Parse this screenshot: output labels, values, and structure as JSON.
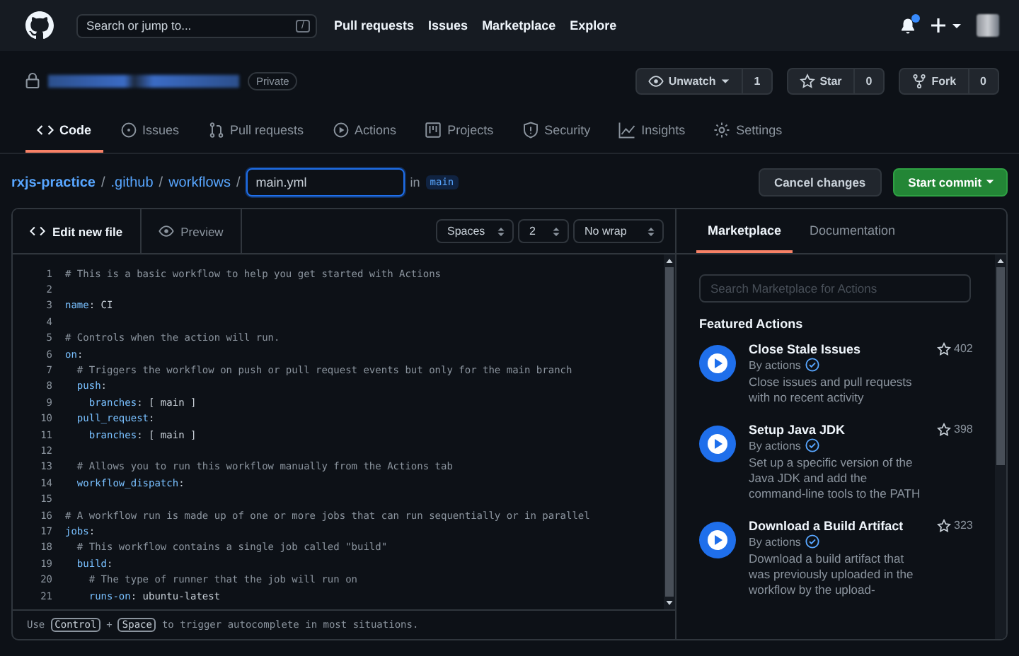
{
  "topnav": {
    "search_placeholder": "Search or jump to...",
    "search_key": "/",
    "links": [
      "Pull requests",
      "Issues",
      "Marketplace",
      "Explore"
    ],
    "notification_unread": true
  },
  "repo": {
    "visibility": "Private",
    "buttons": [
      {
        "label": "Unwatch",
        "count": "1",
        "kind": "watch",
        "caret": true
      },
      {
        "label": "Star",
        "count": "0",
        "kind": "star",
        "caret": false
      },
      {
        "label": "Fork",
        "count": "0",
        "kind": "fork",
        "caret": false
      }
    ]
  },
  "tabs": [
    {
      "label": "Code",
      "kind": "code",
      "selected": true
    },
    {
      "label": "Issues",
      "kind": "issues",
      "selected": false
    },
    {
      "label": "Pull requests",
      "kind": "pulls",
      "selected": false
    },
    {
      "label": "Actions",
      "kind": "actions",
      "selected": false
    },
    {
      "label": "Projects",
      "kind": "projects",
      "selected": false
    },
    {
      "label": "Security",
      "kind": "security",
      "selected": false
    },
    {
      "label": "Insights",
      "kind": "insights",
      "selected": false
    },
    {
      "label": "Settings",
      "kind": "settings",
      "selected": false
    }
  ],
  "breadcrumb": {
    "repo": "rxjs-practice",
    "separator": "/",
    "path": [
      ".github",
      "workflows"
    ],
    "filename": "main.yml",
    "in_label": "in",
    "branch": "main"
  },
  "actions": {
    "cancel": "Cancel changes",
    "commit": "Start commit"
  },
  "editor": {
    "tabs": [
      {
        "label": "Edit new file",
        "kind": "edit",
        "selected": true
      },
      {
        "label": "Preview",
        "kind": "preview",
        "selected": false
      }
    ],
    "selects": [
      "Spaces",
      "2",
      "No wrap"
    ],
    "lines": [
      {
        "number": "1",
        "segments": [
          {
            "kind": "comment",
            "text": "# This is a basic workflow to help you get started with Actions"
          }
        ]
      },
      {
        "number": "2"
      },
      {
        "number": "3",
        "segments": [
          {
            "kind": "key",
            "text": "name"
          },
          {
            "kind": "plain",
            "text": ": CI"
          }
        ]
      },
      {
        "number": "4"
      },
      {
        "number": "5",
        "segments": [
          {
            "kind": "comment",
            "text": "# Controls when the action will run."
          }
        ]
      },
      {
        "number": "6",
        "segments": [
          {
            "kind": "key",
            "text": "on"
          },
          {
            "kind": "plain",
            "text": ":"
          }
        ]
      },
      {
        "number": "7",
        "segments": [
          {
            "kind": "comment",
            "text": "  # Triggers the workflow on push or pull request events but only for the main branch"
          }
        ]
      },
      {
        "number": "8",
        "segments": [
          {
            "kind": "key",
            "text": "  push"
          },
          {
            "kind": "plain",
            "text": ":"
          }
        ]
      },
      {
        "number": "9",
        "segments": [
          {
            "kind": "key",
            "text": "    branches"
          },
          {
            "kind": "plain",
            "text": ": [ main ]"
          }
        ]
      },
      {
        "number": "10",
        "segments": [
          {
            "kind": "key",
            "text": "  pull_request"
          },
          {
            "kind": "plain",
            "text": ":"
          }
        ]
      },
      {
        "number": "11",
        "segments": [
          {
            "kind": "key",
            "text": "    branches"
          },
          {
            "kind": "plain",
            "text": ": [ main ]"
          }
        ]
      },
      {
        "number": "12"
      },
      {
        "number": "13",
        "segments": [
          {
            "kind": "comment",
            "text": "  # Allows you to run this workflow manually from the Actions tab"
          }
        ]
      },
      {
        "number": "14",
        "segments": [
          {
            "kind": "key",
            "text": "  workflow_dispatch"
          },
          {
            "kind": "plain",
            "text": ":"
          }
        ]
      },
      {
        "number": "15"
      },
      {
        "number": "16",
        "segments": [
          {
            "kind": "comment",
            "text": "# A workflow run is made up of one or more jobs that can run sequentially or in parallel"
          }
        ]
      },
      {
        "number": "17",
        "segments": [
          {
            "kind": "key",
            "text": "jobs"
          },
          {
            "kind": "plain",
            "text": ":"
          }
        ]
      },
      {
        "number": "18",
        "segments": [
          {
            "kind": "comment",
            "text": "  # This workflow contains a single job called \"build\""
          }
        ]
      },
      {
        "number": "19",
        "segments": [
          {
            "kind": "key",
            "text": "  build"
          },
          {
            "kind": "plain",
            "text": ":"
          }
        ]
      },
      {
        "number": "20",
        "segments": [
          {
            "kind": "comment",
            "text": "    # The type of runner that the job will run on"
          }
        ]
      },
      {
        "number": "21",
        "segments": [
          {
            "kind": "key",
            "text": "    runs-on"
          },
          {
            "kind": "plain",
            "text": ": ubuntu-latest"
          }
        ]
      }
    ],
    "hint": {
      "before": "Use",
      "key1": "Control",
      "plus": "+",
      "key2": "Space",
      "after": "to trigger autocomplete in most situations."
    }
  },
  "sidebar": {
    "tabs": [
      {
        "label": "Marketplace",
        "selected": true
      },
      {
        "label": "Documentation",
        "selected": false
      }
    ],
    "search_placeholder": "Search Marketplace for Actions",
    "heading": "Featured Actions",
    "items": [
      {
        "title": "Close Stale Issues",
        "author": "By actions",
        "verified": true,
        "stars": "402",
        "description": "Close issues and pull requests with no recent activity"
      },
      {
        "title": "Setup Java JDK",
        "author": "By actions",
        "verified": true,
        "stars": "398",
        "description": "Set up a specific version of the Java JDK and add the command-line tools to the PATH"
      },
      {
        "title": "Download a Build Artifact",
        "author": "By actions",
        "verified": true,
        "stars": "323",
        "description": "Download a build artifact that was previously uploaded in the workflow by the upload-"
      }
    ]
  }
}
